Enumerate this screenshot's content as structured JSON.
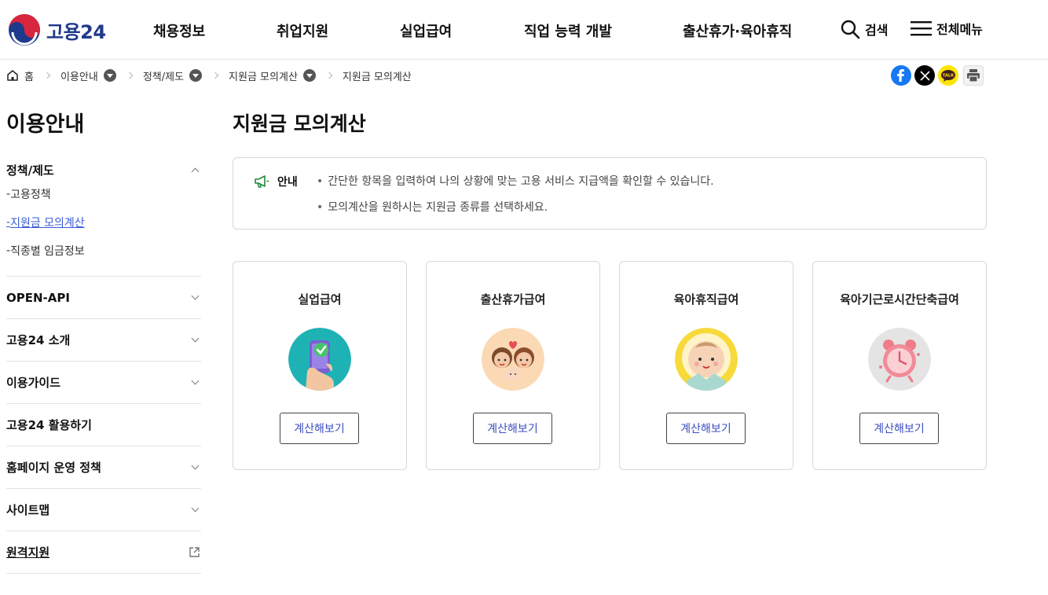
{
  "header": {
    "logo_text": "고용24",
    "nav": [
      "채용정보",
      "취업지원",
      "실업급여",
      "직업 능력 개발",
      "출산휴가·육아휴직"
    ],
    "search_label": "검색",
    "menu_label": "전체메뉴"
  },
  "breadcrumb": {
    "home": "홈",
    "items": [
      "이용안내",
      "정책/제도",
      "지원금 모의계산",
      "지원금 모의계산"
    ]
  },
  "share": {
    "kakao_label": "TALK"
  },
  "sidebar": {
    "title": "이용안내",
    "groups": [
      {
        "label": "정책/제도",
        "subs": [
          "고용정책",
          "지원금 모의계산",
          "직종별 임금정보"
        ]
      },
      {
        "label": "OPEN-API"
      },
      {
        "label": "고용24 소개"
      },
      {
        "label": "이용가이드"
      },
      {
        "label": "고용24 활용하기"
      },
      {
        "label": "홈페이지 운영 정책"
      },
      {
        "label": "사이트맵"
      },
      {
        "label": "원격지원"
      }
    ]
  },
  "main": {
    "title": "지원금 모의계산",
    "notice": {
      "label": "안내",
      "lines": [
        "간단한 항목을 입력하여 나의 상황에 맞는 고용 서비스 지급액을 확인할 수 있습니다.",
        "모의계산을 원하시는 지원금 종류를 선택하세요."
      ]
    },
    "cards": [
      {
        "title": "실업급여",
        "button": "계산해보기"
      },
      {
        "title": "출산휴가급여",
        "button": "계산해보기"
      },
      {
        "title": "육아휴직급여",
        "button": "계산해보기"
      },
      {
        "title": "육아기근로시간단축급여",
        "button": "계산해보기"
      }
    ]
  },
  "colors": {
    "accent": "#3b5bd6",
    "brand": "#1f3a8a",
    "facebook": "#1877f2",
    "kakao": "#fee500"
  }
}
